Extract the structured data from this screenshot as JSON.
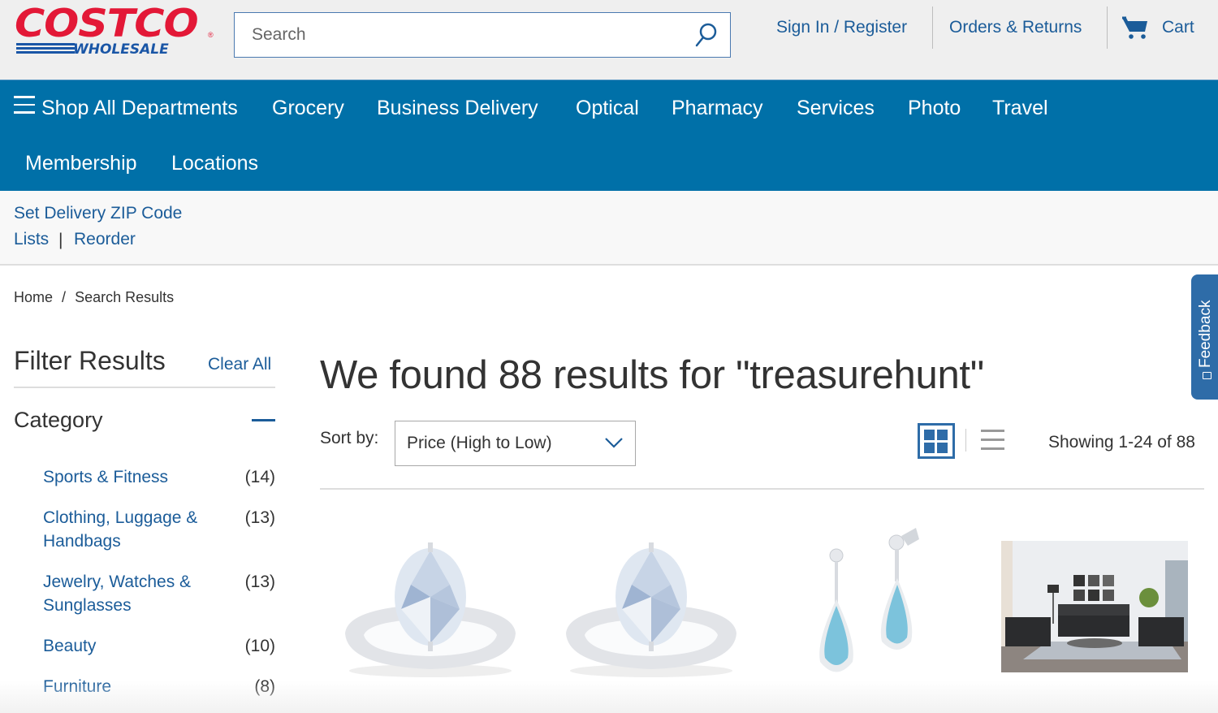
{
  "header": {
    "logo": {
      "primary": "COSTCO",
      "secondary": "WHOLESALE",
      "registered": "®"
    },
    "search": {
      "placeholder": "Search",
      "value": "",
      "icon": "search-icon"
    },
    "links": {
      "sign_in": "Sign In / Register",
      "orders": "Orders & Returns",
      "cart": "Cart",
      "cart_icon": "cart-icon"
    }
  },
  "nav": {
    "shop_all": "Shop All Departments",
    "items": [
      "Grocery",
      "Business Delivery",
      "Optical",
      "Pharmacy",
      "Services",
      "Photo",
      "Travel",
      "Membership",
      "Locations"
    ]
  },
  "subbar": {
    "zip": "Set Delivery ZIP Code",
    "lists": "Lists",
    "separator": "|",
    "reorder": "Reorder"
  },
  "breadcrumb": {
    "items": [
      "Home",
      "Search Results"
    ],
    "separator": "/"
  },
  "feedback": {
    "label": "Feedback"
  },
  "filters": {
    "title": "Filter Results",
    "clear_all": "Clear All",
    "category": {
      "title": "Category",
      "expanded": true,
      "items": [
        {
          "label": "Sports & Fitness",
          "count": "(14)"
        },
        {
          "label": "Clothing, Luggage & Handbags",
          "count": "(13)"
        },
        {
          "label": "Jewelry, Watches & Sunglasses",
          "count": "(13)"
        },
        {
          "label": "Beauty",
          "count": "(10)"
        },
        {
          "label": "Furniture",
          "count": "(8)"
        }
      ]
    }
  },
  "results": {
    "heading": "We found 88 results for \"treasurehunt\"",
    "query": "treasurehunt",
    "total": 88,
    "sort_label": "Sort by:",
    "sort_value": "Price (High to Low)",
    "view_mode": "grid",
    "showing": "Showing 1-24 of 88",
    "products": [
      {
        "image": "oval-diamond-solitaire-ring"
      },
      {
        "image": "oval-diamond-solitaire-ring"
      },
      {
        "image": "aquamarine-diamond-drop-earrings"
      },
      {
        "image": "black-leather-living-room-set"
      }
    ]
  },
  "colors": {
    "brand_red": "#e31837",
    "brand_blue": "#1a56a6",
    "nav_blue": "#0070a8",
    "link_blue": "#1b5c99",
    "feedback_blue": "#2e6ca8"
  }
}
